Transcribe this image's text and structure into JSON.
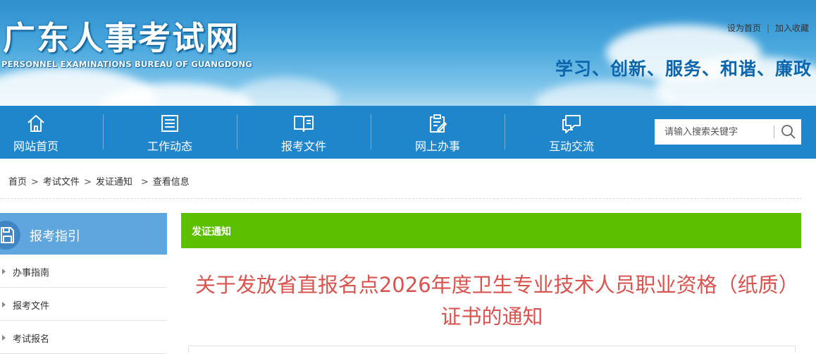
{
  "header": {
    "site_title": "广东人事考试网",
    "site_subtitle": "PERSONNEL EXAMINATIONS BUREAU OF GUANGDONG",
    "top_links": {
      "set_home": "设为首页",
      "separator": "|",
      "favorite": "加入收藏"
    },
    "slogan": "学习、创新、服务、和谐、廉政"
  },
  "nav": {
    "items": [
      {
        "label": "网站首页",
        "icon": "home-icon"
      },
      {
        "label": "工作动态",
        "icon": "news-icon"
      },
      {
        "label": "报考文件",
        "icon": "book-icon"
      },
      {
        "label": "网上办事",
        "icon": "edit-document-icon"
      },
      {
        "label": "互动交流",
        "icon": "chat-icon"
      }
    ],
    "search": {
      "placeholder": "请输入搜索关键字",
      "icon": "search-icon"
    }
  },
  "breadcrumb": {
    "items": [
      "首页",
      "考试文件",
      "发证通知",
      "查看信息"
    ],
    "separator": ">"
  },
  "sidebar": {
    "title": "报考指引",
    "icon": "save-disk-icon",
    "items": [
      {
        "label": "办事指南"
      },
      {
        "label": "报考文件"
      },
      {
        "label": "考试报名"
      }
    ]
  },
  "main": {
    "section_title": "发证通知",
    "article_title": "关于发放省直报名点2026年度卫生专业技术人员职业资格（纸质）证书的通知"
  },
  "colors": {
    "nav_bg": "#1f86cc",
    "slogan": "#0b66ad",
    "section_bar": "#5cc000",
    "article_title": "#d9534f",
    "sidebar_head": "#5fa6df"
  }
}
